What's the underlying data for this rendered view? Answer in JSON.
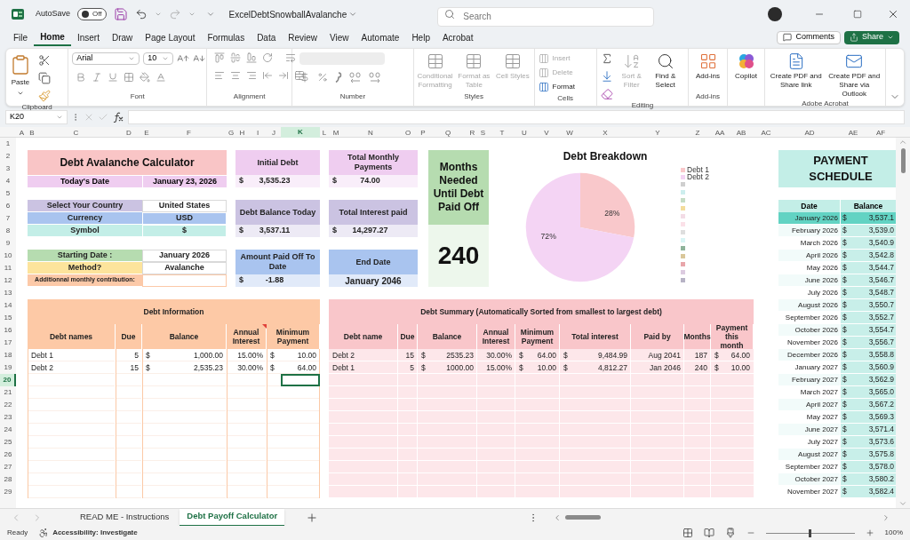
{
  "title_bar": {
    "autosave": {
      "label": "AutoSave",
      "on": false,
      "state_text": "Off"
    },
    "file_name": "ExcelDebtSnowballAvalanche",
    "search": {
      "placeholder": "Search"
    }
  },
  "menu": [
    {
      "label": "File",
      "selected": false
    },
    {
      "label": "Home",
      "selected": true
    },
    {
      "label": "Insert",
      "selected": false
    },
    {
      "label": "Draw",
      "selected": false
    },
    {
      "label": "Page Layout",
      "selected": false
    },
    {
      "label": "Formulas",
      "selected": false
    },
    {
      "label": "Data",
      "selected": false
    },
    {
      "label": "Review",
      "selected": false
    },
    {
      "label": "View",
      "selected": false
    },
    {
      "label": "Automate",
      "selected": false
    },
    {
      "label": "Help",
      "selected": false
    },
    {
      "label": "Acrobat",
      "selected": false
    }
  ],
  "comments_button": "Comments",
  "share_button": "Share",
  "ribbon": [
    {
      "kind": "clipboard",
      "label": "Clipboard",
      "paste": "Paste"
    },
    {
      "kind": "font",
      "label": "Font",
      "font_name": "Arial",
      "font_size": "10"
    },
    {
      "kind": "alignment",
      "label": "Alignment"
    },
    {
      "kind": "number",
      "label": "Number"
    },
    {
      "kind": "styles",
      "label": "Styles",
      "buttons": [
        {
          "label": "Conditional Formatting",
          "disabled": true
        },
        {
          "label": "Format as Table",
          "disabled": true
        },
        {
          "label": "Cell Styles",
          "disabled": true
        }
      ]
    },
    {
      "kind": "cells",
      "label": "Cells",
      "buttons": [
        {
          "label": "Insert",
          "disabled": true
        },
        {
          "label": "Delete",
          "disabled": true
        },
        {
          "label": "Format",
          "disabled": false
        }
      ]
    },
    {
      "kind": "editing",
      "label": "Editing",
      "buttons": [
        {
          "label": "Sort & Filter",
          "disabled": true
        },
        {
          "label": "Find & Select",
          "disabled": false
        }
      ]
    },
    {
      "kind": "addins",
      "label": "Add-ins",
      "buttons": [
        {
          "label": "Add-ins",
          "disabled": false
        }
      ]
    },
    {
      "kind": "copilot",
      "buttons": [
        {
          "label": "Copilot",
          "disabled": false
        }
      ]
    },
    {
      "kind": "acrobat",
      "label": "Adobe Acrobat",
      "buttons": [
        {
          "label": "Create PDF and Share link",
          "disabled": false
        },
        {
          "label": "Create PDF and Share via Outlook",
          "disabled": false
        }
      ]
    }
  ],
  "formula_bar": {
    "name_box": "K20"
  },
  "column_headers": [
    {
      "label": "A",
      "selected": false
    },
    {
      "label": "B",
      "selected": false
    },
    {
      "label": "C",
      "selected": false
    },
    {
      "label": "D",
      "selected": false
    },
    {
      "label": "E",
      "selected": false
    },
    {
      "label": "F",
      "selected": false
    },
    {
      "label": "G",
      "selected": false
    },
    {
      "label": "H",
      "selected": false
    },
    {
      "label": "I",
      "selected": false
    },
    {
      "label": "J",
      "selected": false
    },
    {
      "label": "K",
      "selected": true
    },
    {
      "label": "L",
      "selected": false
    },
    {
      "label": "M",
      "selected": false
    },
    {
      "label": "N",
      "selected": false
    },
    {
      "label": "O",
      "selected": false
    },
    {
      "label": "P",
      "selected": false
    },
    {
      "label": "Q",
      "selected": false
    },
    {
      "label": "R",
      "selected": false
    },
    {
      "label": "S",
      "selected": false
    },
    {
      "label": "T",
      "selected": false
    },
    {
      "label": "U",
      "selected": false
    },
    {
      "label": "V",
      "selected": false
    },
    {
      "label": "W",
      "selected": false
    },
    {
      "label": "X",
      "selected": false
    },
    {
      "label": "Y",
      "selected": false
    },
    {
      "label": "Z",
      "selected": false
    },
    {
      "label": "AA",
      "selected": false
    },
    {
      "label": "AB",
      "selected": false
    },
    {
      "label": "AC",
      "selected": false
    },
    {
      "label": "AD",
      "selected": false
    },
    {
      "label": "AE",
      "selected": false
    },
    {
      "label": "AF",
      "selected": false
    }
  ],
  "row_headers": [
    {
      "label": "1",
      "selected": false
    },
    {
      "label": "2",
      "selected": false
    },
    {
      "label": "3",
      "selected": false
    },
    {
      "label": "4",
      "selected": false
    },
    {
      "label": "5",
      "selected": false
    },
    {
      "label": "6",
      "selected": false
    },
    {
      "label": "7",
      "selected": false
    },
    {
      "label": "8",
      "selected": false
    },
    {
      "label": "9",
      "selected": false
    },
    {
      "label": "10",
      "selected": false
    },
    {
      "label": "11",
      "selected": false
    },
    {
      "label": "12",
      "selected": false
    },
    {
      "label": "13",
      "selected": false
    },
    {
      "label": "14",
      "selected": false
    },
    {
      "label": "15",
      "selected": false
    },
    {
      "label": "16",
      "selected": false
    },
    {
      "label": "17",
      "selected": false
    },
    {
      "label": "18",
      "selected": false
    },
    {
      "label": "19",
      "selected": false
    },
    {
      "label": "20",
      "selected": true
    },
    {
      "label": "21",
      "selected": false
    },
    {
      "label": "22",
      "selected": false
    },
    {
      "label": "23",
      "selected": false
    },
    {
      "label": "24",
      "selected": false
    },
    {
      "label": "25",
      "selected": false
    },
    {
      "label": "26",
      "selected": false
    },
    {
      "label": "27",
      "selected": false
    },
    {
      "label": "28",
      "selected": false
    },
    {
      "label": "29",
      "selected": false
    }
  ],
  "calculator": {
    "title": "Debt Avalanche Calculator",
    "date_label": "Today's Date",
    "date_value": "January 23, 2026"
  },
  "location_settings": [
    {
      "kind": "field",
      "label": "Select Your Country",
      "value": "United States",
      "color": "#cbc3e2",
      "filled": false
    },
    {
      "kind": "field",
      "label": "Currency",
      "value": "USD",
      "color": "#a9c4ef",
      "filled": true
    },
    {
      "kind": "field",
      "label": "Symbol",
      "value": "$",
      "color": "#c3eee7",
      "filled": true
    }
  ],
  "plan_settings": [
    {
      "kind": "field",
      "label": "Starting Date :",
      "value": "January 2026",
      "color": "#b6dcb0",
      "filled": false
    },
    {
      "kind": "field",
      "label": "Method?",
      "value": "Avalanche",
      "color": "#fde49c",
      "filled": false
    },
    {
      "kind": "note",
      "label": "Additionnal monthly contribution:",
      "color": "#fcc9a8",
      "filled": false
    }
  ],
  "summary_cards": [
    {
      "label": "Initial Debt",
      "symbol": "$",
      "value": "3,535.23",
      "color": "#efcdf0"
    },
    {
      "label": "Total Monthly Payments",
      "symbol": "$",
      "value": "74.00",
      "color": "#efcdf0"
    },
    {
      "label": "Debt Balance Today",
      "symbol": "$",
      "value": "3,537.11",
      "color": "#cbc3e2"
    },
    {
      "label": "Total Interest paid",
      "symbol": "$",
      "value": "14,297.27",
      "color": "#cbc3e2"
    },
    {
      "label": "Amount Paid Off To Date",
      "symbol": "$",
      "value": "-1.88",
      "color": "#a9c4ef"
    },
    {
      "label": "End Date",
      "value": "January 2046",
      "color": "#a9c4ef"
    }
  ],
  "months_needed": {
    "label": "Months Needed Until Debt Paid Off",
    "value": "240"
  },
  "chart": {
    "chart_data": {
      "type": "pie",
      "title": "Debt Breakdown",
      "categories": [
        "Debt 1",
        "Debt 2"
      ],
      "values": [
        28,
        72
      ],
      "colors": [
        "#f9c8cb",
        "#f4d4f4"
      ],
      "value_labels": [
        "28%",
        "72%"
      ],
      "legend": "right"
    },
    "legend_swatches": [
      {
        "color": "#cfcfcf"
      },
      {
        "color": "#cdeeee"
      },
      {
        "color": "#c5dcc5"
      },
      {
        "color": "#f3dc9c"
      },
      {
        "color": "#f3dce6"
      },
      {
        "color": "#fbe1e8"
      },
      {
        "color": "#dedede"
      },
      {
        "color": "#d9f5f5"
      },
      {
        "color": "#8fb39a"
      },
      {
        "color": "#d9c79a"
      },
      {
        "color": "#e8a6aa"
      },
      {
        "color": "#dccbe0"
      },
      {
        "color": "#b7b3c5"
      }
    ]
  },
  "debt_information": {
    "title": "Debt Information",
    "columns": [
      {
        "label": "Debt names",
        "comment": false
      },
      {
        "label": "Due",
        "comment": false
      },
      {
        "label": "Balance",
        "comment": false
      },
      {
        "label": "Annual Interest",
        "comment": true
      },
      {
        "label": "Minimum Payment",
        "comment": false
      }
    ],
    "rows": [
      {
        "cells": [
          "Debt 1",
          "5",
          {
            "symbol": "$",
            "amount": "1,000.00"
          },
          "15.00%",
          {
            "symbol": "$",
            "amount": "10.00"
          }
        ]
      },
      {
        "cells": [
          "Debt 2",
          "15",
          {
            "symbol": "$",
            "amount": "2,535.23"
          },
          "30.00%",
          {
            "symbol": "$",
            "amount": "64.00"
          }
        ]
      }
    ]
  },
  "debt_summary": {
    "title": "Debt Summary (Automatically Sorted from smallest to largest debt)",
    "columns": [
      {
        "label": "Debt name",
        "comment": false
      },
      {
        "label": "Due",
        "comment": false
      },
      {
        "label": "Balance",
        "comment": false
      },
      {
        "label": "Annual Interest",
        "comment": false
      },
      {
        "label": "Minimum Payment",
        "comment": false
      },
      {
        "label": "Total interest",
        "comment": false
      },
      {
        "label": "Paid by",
        "comment": false
      },
      {
        "label": "Months",
        "comment": false
      },
      {
        "label": "Payment this month",
        "comment": false
      }
    ],
    "rows": [
      {
        "cells": [
          "Debt 2",
          "15",
          {
            "symbol": "$",
            "amount": "2535.23"
          },
          "30.00%",
          {
            "symbol": "$",
            "amount": "64.00"
          },
          {
            "symbol": "$",
            "amount": "9,484.99"
          },
          "Aug 2041",
          "187",
          {
            "symbol": "$",
            "amount": "64.00"
          }
        ]
      },
      {
        "cells": [
          "Debt 1",
          "5",
          {
            "symbol": "$",
            "amount": "1000.00"
          },
          "15.00%",
          {
            "symbol": "$",
            "amount": "10.00"
          },
          {
            "symbol": "$",
            "amount": "4,812.27"
          },
          "Jan 2046",
          "240",
          {
            "symbol": "$",
            "amount": "10.00"
          }
        ]
      }
    ]
  },
  "payment_schedule": {
    "title": "PAYMENT SCHEDULE",
    "columns": [
      "Date",
      "Balance"
    ],
    "rows": [
      {
        "date": "January 2026",
        "symbol": "$",
        "balance": "3,537.1",
        "selected": true
      },
      {
        "date": "February 2026",
        "symbol": "$",
        "balance": "3,539.0",
        "selected": false
      },
      {
        "date": "March 2026",
        "symbol": "$",
        "balance": "3,540.9",
        "selected": false
      },
      {
        "date": "April 2026",
        "symbol": "$",
        "balance": "3,542.8",
        "selected": false
      },
      {
        "date": "May 2026",
        "symbol": "$",
        "balance": "3,544.7",
        "selected": false
      },
      {
        "date": "June 2026",
        "symbol": "$",
        "balance": "3,546.7",
        "selected": false
      },
      {
        "date": "July 2026",
        "symbol": "$",
        "balance": "3,548.7",
        "selected": false
      },
      {
        "date": "August 2026",
        "symbol": "$",
        "balance": "3,550.7",
        "selected": false
      },
      {
        "date": "September 2026",
        "symbol": "$",
        "balance": "3,552.7",
        "selected": false
      },
      {
        "date": "October 2026",
        "symbol": "$",
        "balance": "3,554.7",
        "selected": false
      },
      {
        "date": "November 2026",
        "symbol": "$",
        "balance": "3,556.7",
        "selected": false
      },
      {
        "date": "December 2026",
        "symbol": "$",
        "balance": "3,558.8",
        "selected": false
      },
      {
        "date": "January 2027",
        "symbol": "$",
        "balance": "3,560.9",
        "selected": false
      },
      {
        "date": "February 2027",
        "symbol": "$",
        "balance": "3,562.9",
        "selected": false
      },
      {
        "date": "March 2027",
        "symbol": "$",
        "balance": "3,565.0",
        "selected": false
      },
      {
        "date": "April 2027",
        "symbol": "$",
        "balance": "3,567.2",
        "selected": false
      },
      {
        "date": "May 2027",
        "symbol": "$",
        "balance": "3,569.3",
        "selected": false
      },
      {
        "date": "June 2027",
        "symbol": "$",
        "balance": "3,571.4",
        "selected": false
      },
      {
        "date": "July 2027",
        "symbol": "$",
        "balance": "3,573.6",
        "selected": false
      },
      {
        "date": "August 2027",
        "symbol": "$",
        "balance": "3,575.8",
        "selected": false
      },
      {
        "date": "September 2027",
        "symbol": "$",
        "balance": "3,578.0",
        "selected": false
      },
      {
        "date": "October 2027",
        "symbol": "$",
        "balance": "3,580.2",
        "selected": false
      },
      {
        "date": "November 2027",
        "symbol": "$",
        "balance": "3,582.4",
        "selected": false
      }
    ]
  },
  "sheet_tabs": [
    {
      "label": "READ ME - Instructions",
      "selected": false
    },
    {
      "label": "Debt Payoff Calculator",
      "selected": true
    }
  ],
  "status_bar": {
    "status": "Ready",
    "accessibility": "Accessibility: Investigate",
    "zoom": {
      "level": 0.5,
      "reading": "100%"
    }
  }
}
